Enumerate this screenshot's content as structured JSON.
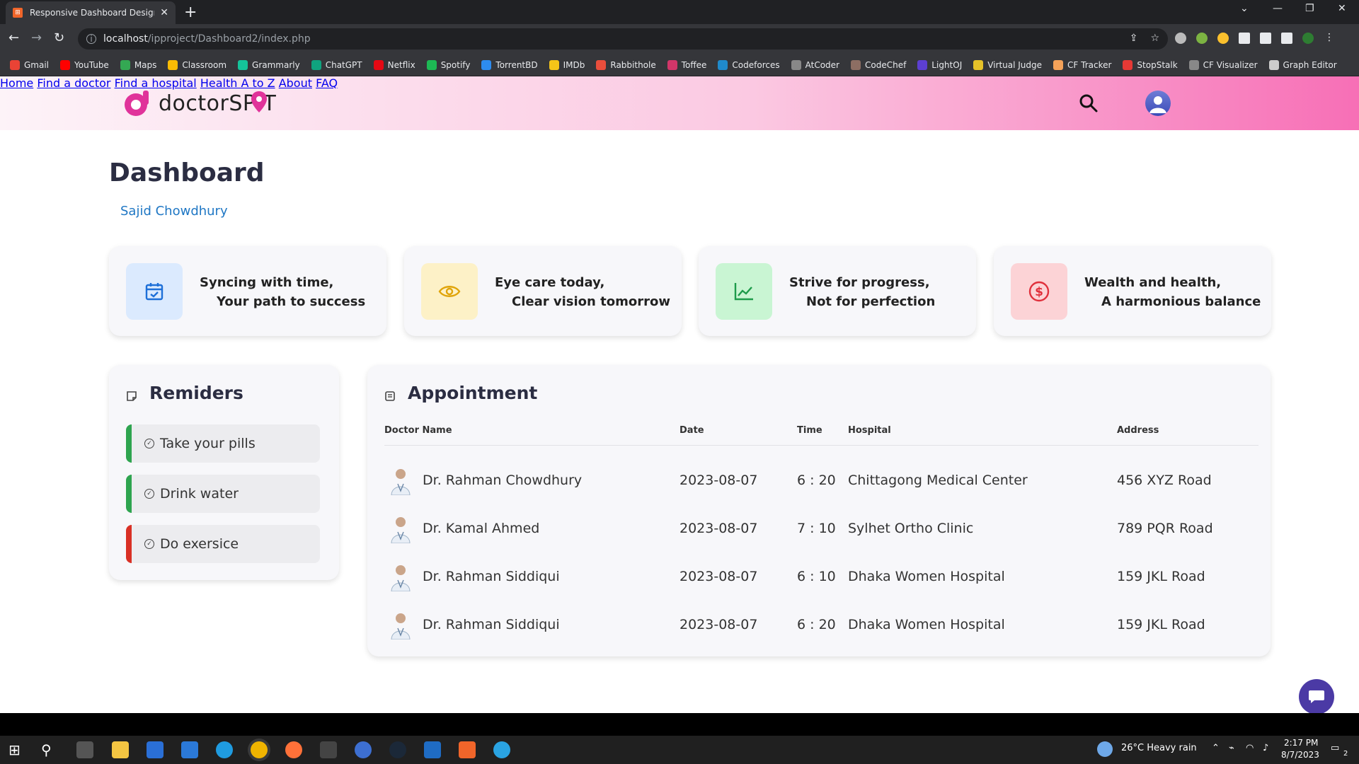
{
  "browser": {
    "tab_title": "Responsive Dashboard Design #...",
    "url_host": "localhost",
    "url_path": "/ipproject/Dashboard2/index.php",
    "bookmarks": [
      "Gmail",
      "YouTube",
      "Maps",
      "Classroom",
      "Grammarly",
      "ChatGPT",
      "Netflix",
      "Spotify",
      "TorrentBD",
      "IMDb",
      "Rabbithole",
      "Toffee",
      "Codeforces",
      "AtCoder",
      "CodeChef",
      "LightOJ",
      "Virtual Judge",
      "CF Tracker",
      "StopStalk",
      "CF Visualizer",
      "Graph Editor"
    ],
    "bookmark_colors": [
      "#ea4335",
      "#ff0000",
      "#34a853",
      "#fbbc04",
      "#15c39a",
      "#10a37f",
      "#e50914",
      "#1db954",
      "#2d8cf0",
      "#f5c518",
      "#e94e3c",
      "#d23669",
      "#1f8acb",
      "#888888",
      "#8d6e63",
      "#5c3fd1",
      "#e6c229",
      "#f4a259",
      "#e53935",
      "#888888",
      "#cccccc"
    ]
  },
  "site": {
    "logo_text": "doctorSP  T",
    "nav": [
      "Home",
      "Find a doctor",
      "Find a hospital",
      "Health A to Z",
      "About",
      "FAQ"
    ]
  },
  "dashboard": {
    "title": "Dashboard",
    "user": "Sajid Chowdhury",
    "cards": [
      {
        "line1": "Syncing with time,",
        "line2": "Your path to success",
        "icon": "calendar-check-icon",
        "bg": "#dbeafe",
        "fg": "#1d6fd8"
      },
      {
        "line1": "Eye care today,",
        "line2": "Clear vision tomorrow",
        "icon": "eye-icon",
        "bg": "#fdf1c7",
        "fg": "#e0a40a"
      },
      {
        "line1": "Strive for progress,",
        "line2": "Not for perfection",
        "icon": "line-chart-icon",
        "bg": "#c9f5d3",
        "fg": "#1d9b4a"
      },
      {
        "line1": "Wealth and health,",
        "line2": "A harmonious balance",
        "icon": "dollar-circle-icon",
        "bg": "#fcd3d6",
        "fg": "#e0303c"
      }
    ]
  },
  "reminders": {
    "title": "Remiders",
    "items": [
      {
        "label": "Take your pills",
        "color": "#2ea44f"
      },
      {
        "label": "Drink water",
        "color": "#2ea44f"
      },
      {
        "label": "Do exersice",
        "color": "#d93025"
      }
    ]
  },
  "appointments": {
    "title": "Appointment",
    "headers": [
      "Doctor Name",
      "Date",
      "Time",
      "Hospital",
      "Address"
    ],
    "rows": [
      {
        "doctor": "Dr. Rahman Chowdhury",
        "date": "2023-08-07",
        "time": "6 : 20",
        "hospital": "Chittagong Medical Center",
        "address": "456 XYZ Road"
      },
      {
        "doctor": "Dr. Kamal Ahmed",
        "date": "2023-08-07",
        "time": "7 : 10",
        "hospital": "Sylhet Ortho Clinic",
        "address": "789 PQR Road"
      },
      {
        "doctor": "Dr. Rahman Siddiqui",
        "date": "2023-08-07",
        "time": "6 : 10",
        "hospital": "Dhaka Women Hospital",
        "address": "159 JKL Road"
      },
      {
        "doctor": "Dr. Rahman Siddiqui",
        "date": "2023-08-07",
        "time": "6 : 20",
        "hospital": "Dhaka Women Hospital",
        "address": "159 JKL Road"
      }
    ]
  },
  "taskbar": {
    "weather": "26°C  Heavy rain",
    "time": "2:17 PM",
    "date": "8/7/2023",
    "notif_count": "2"
  }
}
